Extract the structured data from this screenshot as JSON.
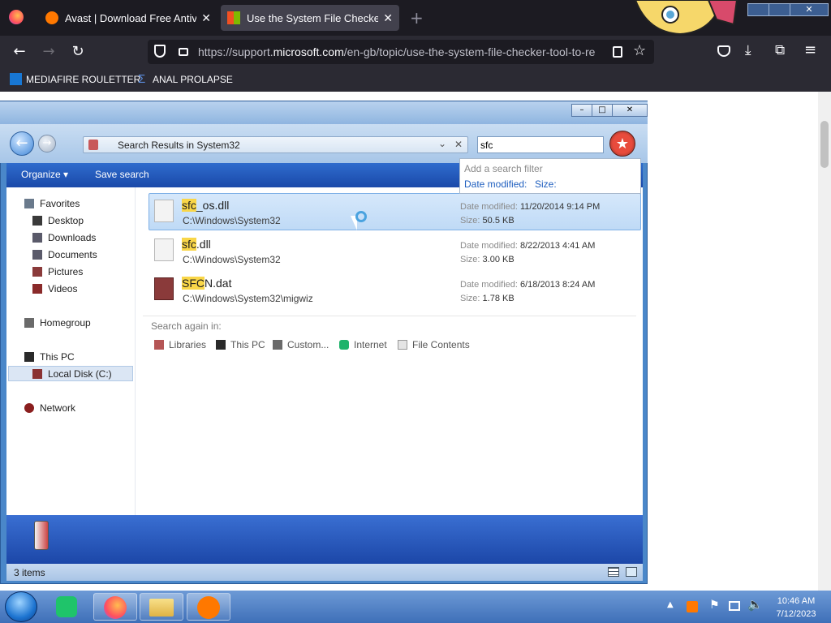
{
  "browser": {
    "tabs": [
      {
        "title": "Avast | Download Free Antivirus"
      },
      {
        "title": "Use the System File Checker tool"
      }
    ],
    "new_tab_label": "+",
    "url_prefix": "https://support.",
    "url_domain": "microsoft.com",
    "url_rest": "/en-gb/topic/use-the-system-file-checker-tool-to-re",
    "bookmarks": [
      {
        "label": "MEDIAFIRE ROULETTER"
      },
      {
        "label": "ANAL PROLAPSE"
      }
    ]
  },
  "explorer": {
    "window_controls": {
      "minimize": "–",
      "maximize": "□",
      "close": "✕"
    },
    "address": "Search Results in System32",
    "search_value": "sfc",
    "commands": {
      "organize": "Organize ▾",
      "save_search": "Save search"
    },
    "filter_popup": {
      "title": "Add a search filter",
      "date_modified": "Date modified:",
      "size": "Size:"
    },
    "nav": {
      "favorites": "Favorites",
      "favorites_items": [
        "Desktop",
        "Downloads",
        "Documents",
        "Pictures",
        "Videos"
      ],
      "homegroup": "Homegroup",
      "this_pc": "This PC",
      "local_disk": "Local Disk (C:)",
      "network": "Network"
    },
    "results": [
      {
        "match": "sfc",
        "rest": "_os.dll",
        "path": "C:\\Windows\\System32",
        "date_label": "Date modified:",
        "date": "11/20/2014 9:14 PM",
        "size_label": "Size:",
        "size": "50.5 KB"
      },
      {
        "match": "sfc",
        "rest": ".dll",
        "path": "C:\\Windows\\System32",
        "date_label": "Date modified:",
        "date": "8/22/2013 4:41 AM",
        "size_label": "Size:",
        "size": "3.00 KB"
      },
      {
        "match": "SFC",
        "rest": "N.dat",
        "path": "C:\\Windows\\System32\\migwiz",
        "date_label": "Date modified:",
        "date": "6/18/2013 8:24 AM",
        "size_label": "Size:",
        "size": "1.78 KB"
      }
    ],
    "search_again": {
      "label": "Search again in:",
      "options": [
        "Libraries",
        "This PC",
        "Custom...",
        "Internet",
        "File Contents"
      ]
    },
    "status_count": "3 items"
  },
  "taskbar": {
    "time": "10:46 AM",
    "date": "7/12/2023"
  }
}
